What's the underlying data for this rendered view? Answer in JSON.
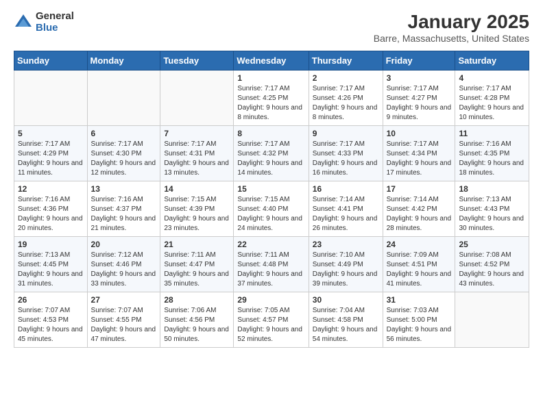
{
  "header": {
    "logo_general": "General",
    "logo_blue": "Blue",
    "month_title": "January 2025",
    "location": "Barre, Massachusetts, United States"
  },
  "days_of_week": [
    "Sunday",
    "Monday",
    "Tuesday",
    "Wednesday",
    "Thursday",
    "Friday",
    "Saturday"
  ],
  "weeks": [
    [
      {
        "day": "",
        "info": ""
      },
      {
        "day": "",
        "info": ""
      },
      {
        "day": "",
        "info": ""
      },
      {
        "day": "1",
        "info": "Sunrise: 7:17 AM\nSunset: 4:25 PM\nDaylight: 9 hours\nand 8 minutes."
      },
      {
        "day": "2",
        "info": "Sunrise: 7:17 AM\nSunset: 4:26 PM\nDaylight: 9 hours\nand 8 minutes."
      },
      {
        "day": "3",
        "info": "Sunrise: 7:17 AM\nSunset: 4:27 PM\nDaylight: 9 hours\nand 9 minutes."
      },
      {
        "day": "4",
        "info": "Sunrise: 7:17 AM\nSunset: 4:28 PM\nDaylight: 9 hours\nand 10 minutes."
      }
    ],
    [
      {
        "day": "5",
        "info": "Sunrise: 7:17 AM\nSunset: 4:29 PM\nDaylight: 9 hours\nand 11 minutes."
      },
      {
        "day": "6",
        "info": "Sunrise: 7:17 AM\nSunset: 4:30 PM\nDaylight: 9 hours\nand 12 minutes."
      },
      {
        "day": "7",
        "info": "Sunrise: 7:17 AM\nSunset: 4:31 PM\nDaylight: 9 hours\nand 13 minutes."
      },
      {
        "day": "8",
        "info": "Sunrise: 7:17 AM\nSunset: 4:32 PM\nDaylight: 9 hours\nand 14 minutes."
      },
      {
        "day": "9",
        "info": "Sunrise: 7:17 AM\nSunset: 4:33 PM\nDaylight: 9 hours\nand 16 minutes."
      },
      {
        "day": "10",
        "info": "Sunrise: 7:17 AM\nSunset: 4:34 PM\nDaylight: 9 hours\nand 17 minutes."
      },
      {
        "day": "11",
        "info": "Sunrise: 7:16 AM\nSunset: 4:35 PM\nDaylight: 9 hours\nand 18 minutes."
      }
    ],
    [
      {
        "day": "12",
        "info": "Sunrise: 7:16 AM\nSunset: 4:36 PM\nDaylight: 9 hours\nand 20 minutes."
      },
      {
        "day": "13",
        "info": "Sunrise: 7:16 AM\nSunset: 4:37 PM\nDaylight: 9 hours\nand 21 minutes."
      },
      {
        "day": "14",
        "info": "Sunrise: 7:15 AM\nSunset: 4:39 PM\nDaylight: 9 hours\nand 23 minutes."
      },
      {
        "day": "15",
        "info": "Sunrise: 7:15 AM\nSunset: 4:40 PM\nDaylight: 9 hours\nand 24 minutes."
      },
      {
        "day": "16",
        "info": "Sunrise: 7:14 AM\nSunset: 4:41 PM\nDaylight: 9 hours\nand 26 minutes."
      },
      {
        "day": "17",
        "info": "Sunrise: 7:14 AM\nSunset: 4:42 PM\nDaylight: 9 hours\nand 28 minutes."
      },
      {
        "day": "18",
        "info": "Sunrise: 7:13 AM\nSunset: 4:43 PM\nDaylight: 9 hours\nand 30 minutes."
      }
    ],
    [
      {
        "day": "19",
        "info": "Sunrise: 7:13 AM\nSunset: 4:45 PM\nDaylight: 9 hours\nand 31 minutes."
      },
      {
        "day": "20",
        "info": "Sunrise: 7:12 AM\nSunset: 4:46 PM\nDaylight: 9 hours\nand 33 minutes."
      },
      {
        "day": "21",
        "info": "Sunrise: 7:11 AM\nSunset: 4:47 PM\nDaylight: 9 hours\nand 35 minutes."
      },
      {
        "day": "22",
        "info": "Sunrise: 7:11 AM\nSunset: 4:48 PM\nDaylight: 9 hours\nand 37 minutes."
      },
      {
        "day": "23",
        "info": "Sunrise: 7:10 AM\nSunset: 4:49 PM\nDaylight: 9 hours\nand 39 minutes."
      },
      {
        "day": "24",
        "info": "Sunrise: 7:09 AM\nSunset: 4:51 PM\nDaylight: 9 hours\nand 41 minutes."
      },
      {
        "day": "25",
        "info": "Sunrise: 7:08 AM\nSunset: 4:52 PM\nDaylight: 9 hours\nand 43 minutes."
      }
    ],
    [
      {
        "day": "26",
        "info": "Sunrise: 7:07 AM\nSunset: 4:53 PM\nDaylight: 9 hours\nand 45 minutes."
      },
      {
        "day": "27",
        "info": "Sunrise: 7:07 AM\nSunset: 4:55 PM\nDaylight: 9 hours\nand 47 minutes."
      },
      {
        "day": "28",
        "info": "Sunrise: 7:06 AM\nSunset: 4:56 PM\nDaylight: 9 hours\nand 50 minutes."
      },
      {
        "day": "29",
        "info": "Sunrise: 7:05 AM\nSunset: 4:57 PM\nDaylight: 9 hours\nand 52 minutes."
      },
      {
        "day": "30",
        "info": "Sunrise: 7:04 AM\nSunset: 4:58 PM\nDaylight: 9 hours\nand 54 minutes."
      },
      {
        "day": "31",
        "info": "Sunrise: 7:03 AM\nSunset: 5:00 PM\nDaylight: 9 hours\nand 56 minutes."
      },
      {
        "day": "",
        "info": ""
      }
    ]
  ]
}
